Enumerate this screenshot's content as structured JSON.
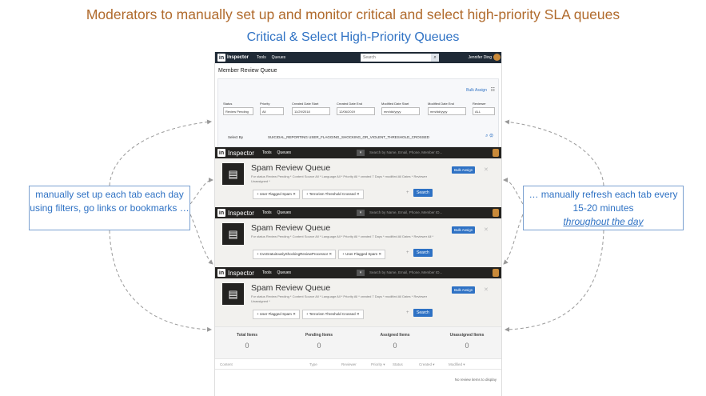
{
  "slide": {
    "headline": "Moderators to manually set up and monitor critical and select high-priority SLA queues",
    "subhead": "Critical & Select High-Priority Queues"
  },
  "base": {
    "logo": "in",
    "brand": "Inspector",
    "menu": "Tools     Queues",
    "search_placeholder": "Search",
    "user": "Jennifer Ding",
    "title": "Member Review Queue",
    "bulk_assign": "Bulk Assign",
    "filters": [
      {
        "label": "Status",
        "value": "Review Pending"
      },
      {
        "label": "Priority",
        "value": "All"
      },
      {
        "label": "Created Date Start",
        "value": "11/29/2018"
      },
      {
        "label": "Created Date End",
        "value": "12/06/2019"
      },
      {
        "label": "Modified Date Start",
        "value": "mm/dd/yyyy"
      },
      {
        "label": "Modified Date End",
        "value": "mm/dd/yyyy"
      },
      {
        "label": "Reviewer",
        "value": "ALL"
      }
    ],
    "select_by_label": "Select By",
    "select_by_values": "SUICIDAL_REPORTING   USER_FLAGGING_SHOCKING_OR_VIOLENT_THRESHOLD_CROSSED"
  },
  "cards": [
    {
      "brand": "Inspector",
      "menu": "Tools     Queues",
      "search_placeholder": "Search by Name, Email, Phone, Member ID...",
      "title": "Spam Review Queue",
      "meta": "For status Review Pending * Content Source All * Language All * Priority All * created 7 Days * modified All Dates * Reviewer Unassigned *",
      "tags": [
        "+ User Flagged Spam ✕",
        "+ Terrorism Threshold Crossed ✕"
      ],
      "search_button": "Search",
      "bulk_assign": "Bulk Assign"
    },
    {
      "brand": "Inspector",
      "menu": "Tools     Queues",
      "search_placeholder": "Search by Name, Email, Phone, Member ID...",
      "title": "Spam Review Queue",
      "meta": "For status Review Pending * Content Source All * Language All * Priority All * created 7 Days * modified All Dates * Reviewer All *",
      "tags": [
        "+ CvsGratuitouslyShockingReviewProcessor ✕",
        "+ User Flagged Spam ✕"
      ],
      "search_button": "Search",
      "bulk_assign": "Bulk Assign"
    },
    {
      "brand": "Inspector",
      "menu": "Tools     Queues",
      "search_placeholder": "Search by Name, Email, Phone, Member ID...",
      "title": "Spam Review Queue",
      "meta": "For status Review Pending * Content Source All * Language All * Priority All * created 7 Days * modified All Dates * Reviewer Unassigned *",
      "tags": [
        "+ User Flagged Spam ✕",
        "+ Terrorism Threshold Crossed ✕"
      ],
      "search_button": "Search",
      "bulk_assign": "Bulk Assign"
    }
  ],
  "stats": [
    {
      "label": "Total Items",
      "value": "0"
    },
    {
      "label": "Pending Items",
      "value": "0"
    },
    {
      "label": "Assigned Items",
      "value": "0"
    },
    {
      "label": "Unassigned Items",
      "value": "0"
    }
  ],
  "table": {
    "columns": [
      "Content",
      "Type",
      "Reviewer",
      "Priority ▾",
      "Status",
      "Created ▾",
      "Modified ▾"
    ],
    "empty": "No review items to display"
  },
  "callouts": {
    "left": "manually set up each tab each day using filters, go links or bookmarks …",
    "right_line1": "… manually refresh each tab every 15-20 minutes",
    "right_line2": "throughout the day"
  },
  "colors": {
    "headline": "#b06a2c",
    "accent": "#2f72c4",
    "dark_bar": "#232220"
  }
}
